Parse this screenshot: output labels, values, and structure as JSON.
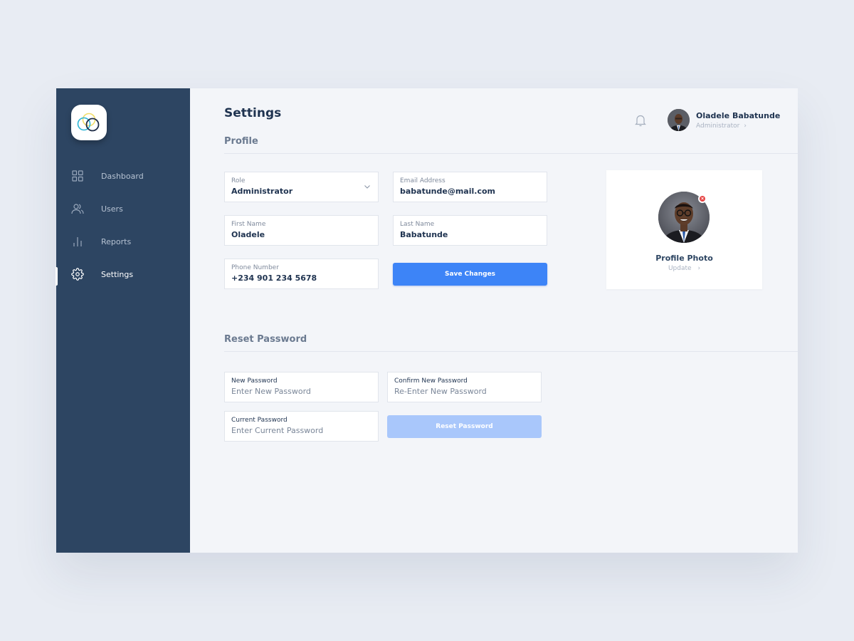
{
  "colors": {
    "sidebar": "#2d4562",
    "accent": "#3d84f7",
    "accent_disabled": "#a9c7fb",
    "danger": "#e64545",
    "background": "#f3f5f9"
  },
  "sidebar": {
    "logo": "overlapping-rings-logo",
    "items": [
      {
        "label": "Dashboard",
        "icon": "grid-icon",
        "active": false
      },
      {
        "label": "Users",
        "icon": "users-icon",
        "active": false
      },
      {
        "label": "Reports",
        "icon": "bar-chart-icon",
        "active": false
      },
      {
        "label": "Settings",
        "icon": "gear-icon",
        "active": true
      }
    ]
  },
  "header": {
    "title": "Settings",
    "notification_icon": "bell-icon",
    "user": {
      "name": "Oladele Babatunde",
      "role": "Administrator",
      "chevron": "›"
    }
  },
  "profile": {
    "section_title": "Profile",
    "fields": {
      "role": {
        "label": "Role",
        "value": "Administrator"
      },
      "email": {
        "label": "Email Address",
        "value": "babatunde@mail.com"
      },
      "first_name": {
        "label": "First Name",
        "value": "Oladele"
      },
      "last_name": {
        "label": "Last Name",
        "value": "Babatunde"
      },
      "phone": {
        "label": "Phone Number",
        "value": "+234 901 234 5678"
      }
    },
    "save_label": "Save Changes",
    "photo": {
      "title": "Profile Photo",
      "update_label": "Update",
      "chevron": "›",
      "remove_glyph": "×"
    }
  },
  "reset_password": {
    "section_title": "Reset Password",
    "fields": {
      "new": {
        "label": "New Password",
        "placeholder": "Enter New Password"
      },
      "confirm": {
        "label": "Confirm New Password",
        "placeholder": "Re-Enter New Password"
      },
      "current": {
        "label": "Current Password",
        "placeholder": "Enter Current Password"
      }
    },
    "reset_label": "Reset Password"
  }
}
